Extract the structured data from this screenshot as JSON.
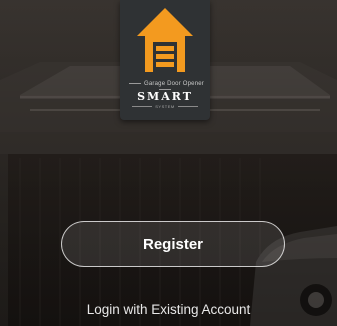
{
  "logo": {
    "icon": "garage-house-icon",
    "small_text": "Garage Door Opener",
    "big_text": "SMART",
    "tiny_text": "SYSTEM",
    "accent_color": "#f39a1f"
  },
  "buttons": {
    "register_label": "Register",
    "login_label": "Login with Existing Account"
  }
}
